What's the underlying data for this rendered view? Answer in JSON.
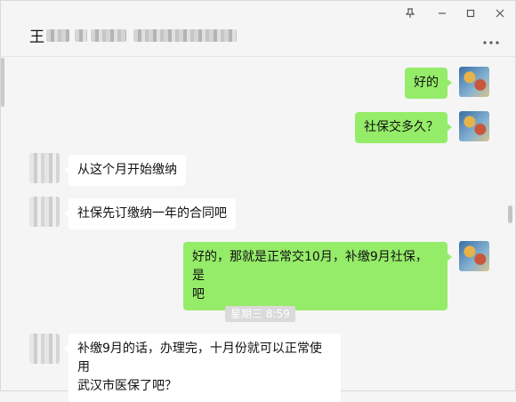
{
  "header": {
    "contact_name": "王",
    "more_icon": "more-dots-icon",
    "window_controls": {
      "pin": "pin-icon",
      "minimize": "minimize-icon",
      "maximize": "maximize-icon",
      "close": "close-icon"
    }
  },
  "colors": {
    "sent_bubble": "#95ec69",
    "received_bubble": "#ffffff",
    "background": "#f5f5f5"
  },
  "messages": [
    {
      "from": "me",
      "text": "好的"
    },
    {
      "from": "me",
      "text": "社保交多久？"
    },
    {
      "from": "other",
      "text": "从这个月开始缴纳"
    },
    {
      "from": "other",
      "text": "社保先订缴纳一年的合同吧"
    },
    {
      "from": "me",
      "text_line1": "好的，那就是正常交10月，补缴9月社保，是",
      "text_line2": "吧"
    },
    {
      "from": "other",
      "text_line1": "补缴9月的话，办理完，十月份就可以正常使用",
      "text_line2": "武汉市医保了吧？"
    }
  ],
  "timestamp": "星期三 8:59"
}
